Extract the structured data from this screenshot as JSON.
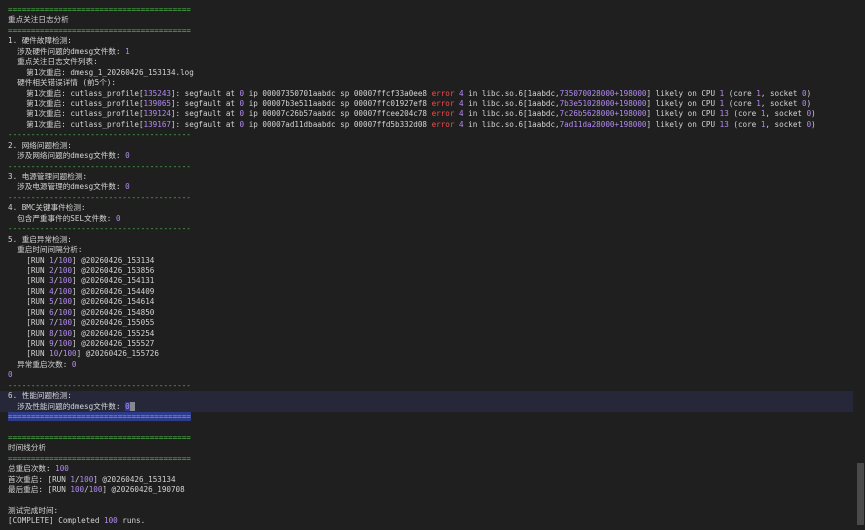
{
  "colors": {
    "background": "#1f1f1f",
    "text": "#d4d4d4",
    "separator": "#4ec94e",
    "number": "#b48cf2",
    "error": "#f14c4c"
  },
  "terminal": {
    "sep_eq": "========================================",
    "sep_dash": "----------------------------------------",
    "section_title": "重点关注日志分析",
    "hw": {
      "title": "1. 硬件故障检测:",
      "count_label": "  涉及硬件问题的dmesg文件数: ",
      "count": "1",
      "files_label": "  重点关注日志文件列表:",
      "file_line": "    第1次重启: dmesg_1_20260426_153134.log",
      "details_label": "  硬件相关错误详情 (前5个):",
      "errors": [
        {
          "prefix": "    第1次重启: cutlass_profile[",
          "pid": "135243",
          "mid1": "]: segfault at ",
          "zero": "0",
          "mid2": " ip 00007350701aabdc sp 00007ffcf33a0ee8 ",
          "err": "error",
          "num4": "4",
          "mid3": " in libc.so.6[1aabdc,",
          "addr": "735070028000",
          "plus": "+",
          "size": "198000",
          "mid4": "] likely on CPU ",
          "cpu": "1",
          "mid5": " (core ",
          "core": "1",
          "mid6": ", socket ",
          "sock": "0",
          "end": ")"
        },
        {
          "prefix": "    第1次重启: cutlass_profile[",
          "pid": "139065",
          "mid1": "]: segfault at ",
          "zero": "0",
          "mid2": " ip 00007b3e511aabdc sp 00007ffc01927ef8 ",
          "err": "error",
          "num4": "4",
          "mid3": " in libc.so.6[1aabdc,",
          "addr": "7b3e51028000",
          "plus": "+",
          "size": "198000",
          "mid4": "] likely on CPU ",
          "cpu": "1",
          "mid5": " (core ",
          "core": "1",
          "mid6": ", socket ",
          "sock": "0",
          "end": ")"
        },
        {
          "prefix": "    第1次重启: cutlass_profile[",
          "pid": "139124",
          "mid1": "]: segfault at ",
          "zero": "0",
          "mid2": " ip 00007c26b57aabdc sp 00007ffcee204c78 ",
          "err": "error",
          "num4": "4",
          "mid3": " in libc.so.6[1aabdc,",
          "addr": "7c26b5628000",
          "plus": "+",
          "size": "198000",
          "mid4": "] likely on CPU ",
          "cpu": "13",
          "mid5": " (core ",
          "core": "1",
          "mid6": ", socket ",
          "sock": "0",
          "end": ")"
        },
        {
          "prefix": "    第1次重启: cutlass_profile[",
          "pid": "139167",
          "mid1": "]: segfault at ",
          "zero": "0",
          "mid2": " ip 00007ad11dbaabdc sp 00007ffd5b332d08 ",
          "err": "error",
          "num4": "4",
          "mid3": " in libc.so.6[1aabdc,",
          "addr": "7ad11da28000",
          "plus": "+",
          "size": "198000",
          "mid4": "] likely on CPU ",
          "cpu": "13",
          "mid5": " (core ",
          "core": "1",
          "mid6": ", socket ",
          "sock": "0",
          "end": ")"
        }
      ]
    },
    "net": {
      "title": "2. 网络问题检测:",
      "count_label": "  涉及网络问题的dmesg文件数: ",
      "count": "0"
    },
    "power": {
      "title": "3. 电源管理问题检测:",
      "count_label": "  涉及电源管理的dmesg文件数: ",
      "count": "0"
    },
    "bmc": {
      "title": "4. BMC关键事件检测:",
      "count_label": "  包含严重事件的SEL文件数: ",
      "count": "0"
    },
    "reboot": {
      "title": "5. 重启异常检测:",
      "interval_label": "  重启时间间隔分析:",
      "runs": [
        {
          "n": "1",
          "total": "100",
          "ts": "@20260426_153134"
        },
        {
          "n": "2",
          "total": "100",
          "ts": "@20260426_153856"
        },
        {
          "n": "3",
          "total": "100",
          "ts": "@20260426_154131"
        },
        {
          "n": "4",
          "total": "100",
          "ts": "@20260426_154409"
        },
        {
          "n": "5",
          "total": "100",
          "ts": "@20260426_154614"
        },
        {
          "n": "6",
          "total": "100",
          "ts": "@20260426_154850"
        },
        {
          "n": "7",
          "total": "100",
          "ts": "@20260426_155055"
        },
        {
          "n": "8",
          "total": "100",
          "ts": "@20260426_155254"
        },
        {
          "n": "9",
          "total": "100",
          "ts": "@20260426_155527"
        },
        {
          "n": "10",
          "total": "100",
          "ts": "@20260426_155726"
        }
      ],
      "abnormal_label": "  异常重启次数: ",
      "abnormal_count": "0",
      "tail": "0"
    },
    "perf": {
      "title": "6. 性能问题检测:",
      "count_label": "  涉及性能问题的dmesg文件数: ",
      "count": "0"
    },
    "timeline": {
      "title": "时间线分析",
      "total_label": "总重启次数: ",
      "total": "100",
      "first_label": "首次重启: [RUN ",
      "first_n": "1",
      "first_total": "100",
      "first_ts": "] @20260426_153134",
      "last_label": "最后重启: [RUN ",
      "last_n": "100",
      "last_total": "100",
      "last_ts": "] @20260426_190708"
    },
    "finish": {
      "title": "测试完成时间:",
      "prefix": "[COMPLETE] Completed ",
      "count": "100",
      "suffix": " runs."
    }
  }
}
